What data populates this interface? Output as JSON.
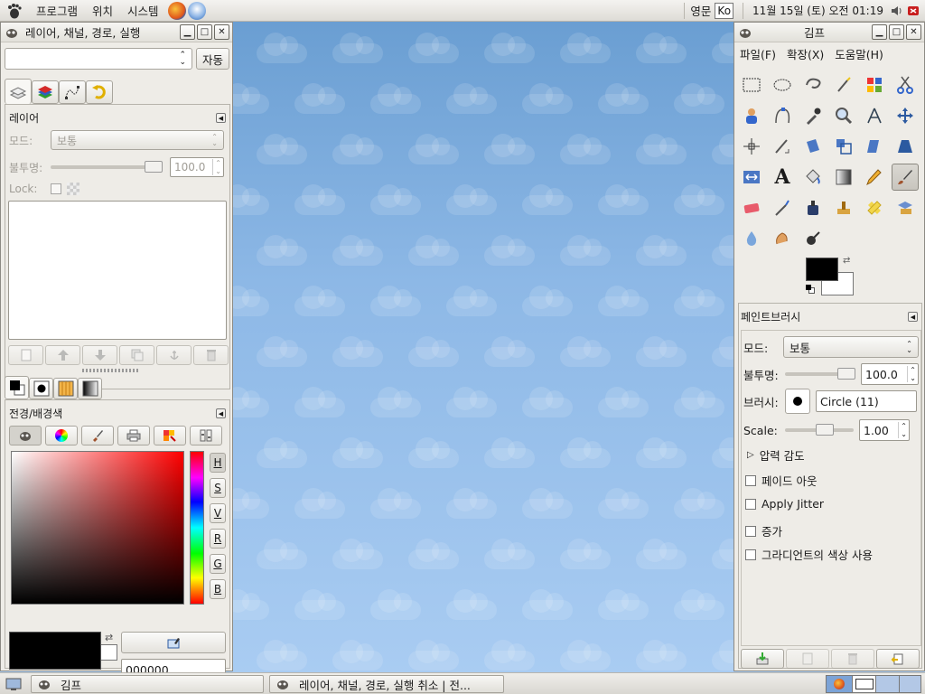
{
  "top_panel": {
    "menus": [
      "프로그램",
      "위치",
      "시스템"
    ],
    "lang_label": "영문",
    "keyboard": "Ko",
    "clock": "11월 15일 (토) 오전 01:19"
  },
  "layers_window": {
    "title": "레이어, 채널, 경로, 실행",
    "auto_button": "자동",
    "layers_section_title": "레이어",
    "mode_label": "모드:",
    "mode_value": "보통",
    "opacity_label": "불투명:",
    "opacity_value": "100.0",
    "lock_label": "Lock:",
    "fg_bg_title": "전경/배경색",
    "channel_labels": [
      "H",
      "S",
      "V",
      "R",
      "G",
      "B"
    ],
    "hex_value": "000000"
  },
  "toolbox_window": {
    "title": "김프",
    "menus": [
      "파일(F)",
      "확장(X)",
      "도움말(H)"
    ],
    "paint_title": "페인트브러시",
    "mode_label": "모드:",
    "mode_value": "보통",
    "opacity_label": "불투명:",
    "opacity_value": "100.0",
    "brush_label": "브러시:",
    "brush_value": "Circle (11)",
    "scale_label": "Scale:",
    "scale_value": "1.00",
    "pressure_label": "압력 감도",
    "options": [
      "페이드 아웃",
      "Apply Jitter",
      "증가",
      "그라디언트의 색상 사용"
    ]
  },
  "taskbar": {
    "tasks": [
      "김프",
      "레이어, 채널, 경로, 실행 취소 | 전..."
    ]
  },
  "colors": {
    "fg": "#000000",
    "bg": "#ffffff",
    "desktop": "#8db8e6"
  }
}
